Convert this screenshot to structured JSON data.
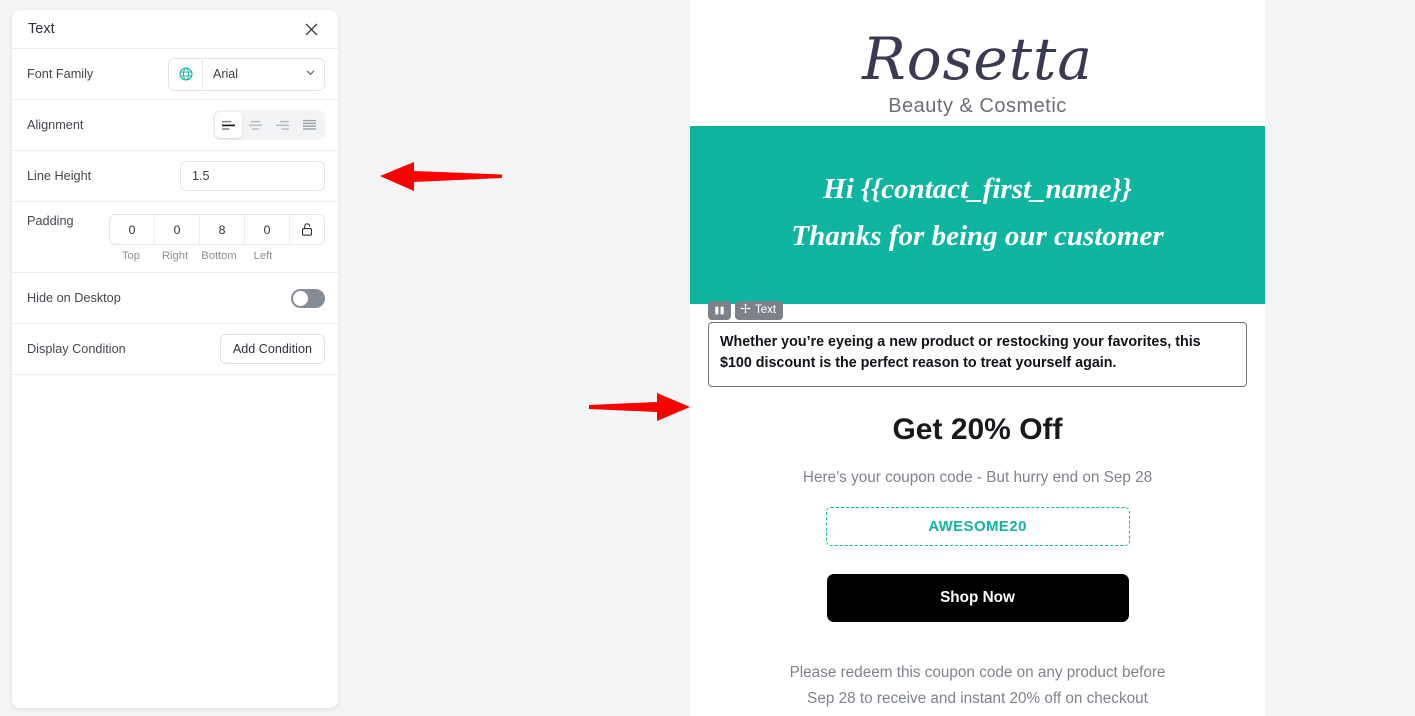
{
  "settings_panel": {
    "title": "Text",
    "close_icon": "close-icon",
    "rows": {
      "font_family": {
        "label": "Font Family",
        "globe_icon": "globe-icon",
        "value": "Arial",
        "chevron_icon": "chevron-down-icon"
      },
      "alignment": {
        "label": "Alignment",
        "options": [
          "align-left",
          "align-center",
          "align-right",
          "align-justify"
        ],
        "selected": "align-left"
      },
      "line_height": {
        "label": "Line Height",
        "value": "1.5"
      },
      "padding": {
        "label": "Padding",
        "values": [
          "0",
          "0",
          "8",
          "0"
        ],
        "sides": [
          "Top",
          "Right",
          "Bottom",
          "Left"
        ],
        "lock_icon": "unlock-icon",
        "locked": false
      },
      "hide_on_desktop": {
        "label": "Hide on Desktop",
        "enabled": false
      },
      "display_condition": {
        "label": "Display Condition",
        "button_label": "Add Condition"
      }
    }
  },
  "email_preview": {
    "logo": {
      "name": "Rosetta",
      "tagline": "Beauty & Cosmetic"
    },
    "hero": {
      "background_color": "#10b5a0",
      "line1": "Hi {{contact_first_name}}",
      "line2": "Thanks for being our customer"
    },
    "selected_block": {
      "toolbar": {
        "columns_icon": "columns-icon",
        "move_icon": "move-arrows-icon",
        "type_label": "Text"
      },
      "text": "Whether you’re eyeing a new product or restocking your favorites, this $100 discount is the perfect reason to treat yourself again."
    },
    "offer": {
      "heading": "Get 20% Off",
      "subheading": "Here’s your coupon code - But hurry end on Sep 28",
      "coupon_code": "AWESOME20",
      "coupon_color": "#13b3a1",
      "cta_label": "Shop Now",
      "footer_line1": "Please redeem this coupon code on any product before",
      "footer_line2": "Sep 28 to receive and instant 20% off on checkout"
    }
  },
  "annotations": {
    "arrow_color": "#fa0000",
    "arrow_left": "arrow-pointing-left",
    "arrow_right": "arrow-pointing-right"
  }
}
